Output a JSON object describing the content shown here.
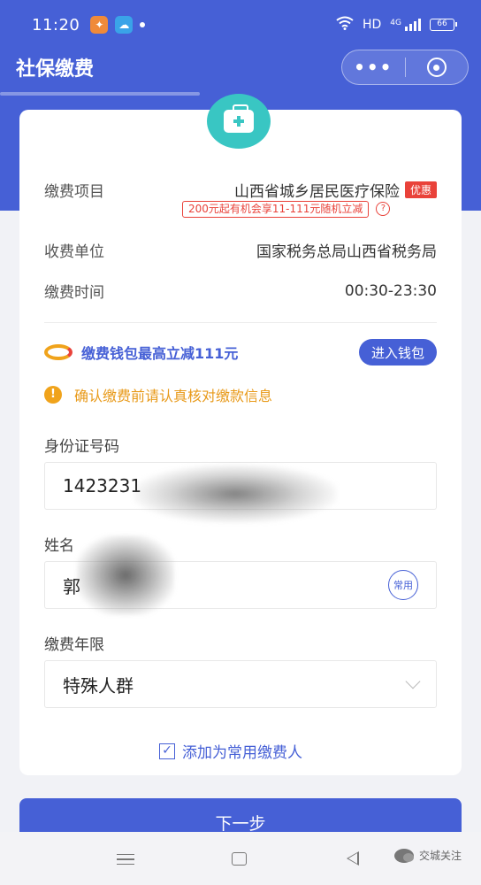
{
  "status_bar": {
    "time": "11:20",
    "hd": "HD",
    "signal": "4G",
    "battery": "66"
  },
  "nav": {
    "title": "社保缴费",
    "more": "•••"
  },
  "card": {
    "item_label": "缴费项目",
    "item_value": "山西省城乡居民医疗保险",
    "discount_tag": "优惠",
    "promo": "200元起有机会享11-111元随机立减",
    "question": "?",
    "unit_label": "收费单位",
    "unit_value": "国家税务总局山西省税务局",
    "time_label": "缴费时间",
    "time_value": "00:30-23:30",
    "wallet_text": "缴费钱包最高立减111元",
    "wallet_button": "进入钱包",
    "warning_icon": "!",
    "warning_text": "确认缴费前请认真核对缴款信息",
    "id_label": "身份证号码",
    "id_value": "1423231",
    "name_label": "姓名",
    "name_value": "郭",
    "common_badge": "常用",
    "years_label": "缴费年限",
    "years_value": "特殊人群",
    "checkbox_mark": "✓",
    "add_common_label": "添加为常用缴费人"
  },
  "next_button": "下一步",
  "watermark": "交城关注",
  "colors": {
    "primary": "#4660d6",
    "teal": "#39c6c3",
    "red": "#e9423a",
    "orange": "#f0a31b"
  }
}
